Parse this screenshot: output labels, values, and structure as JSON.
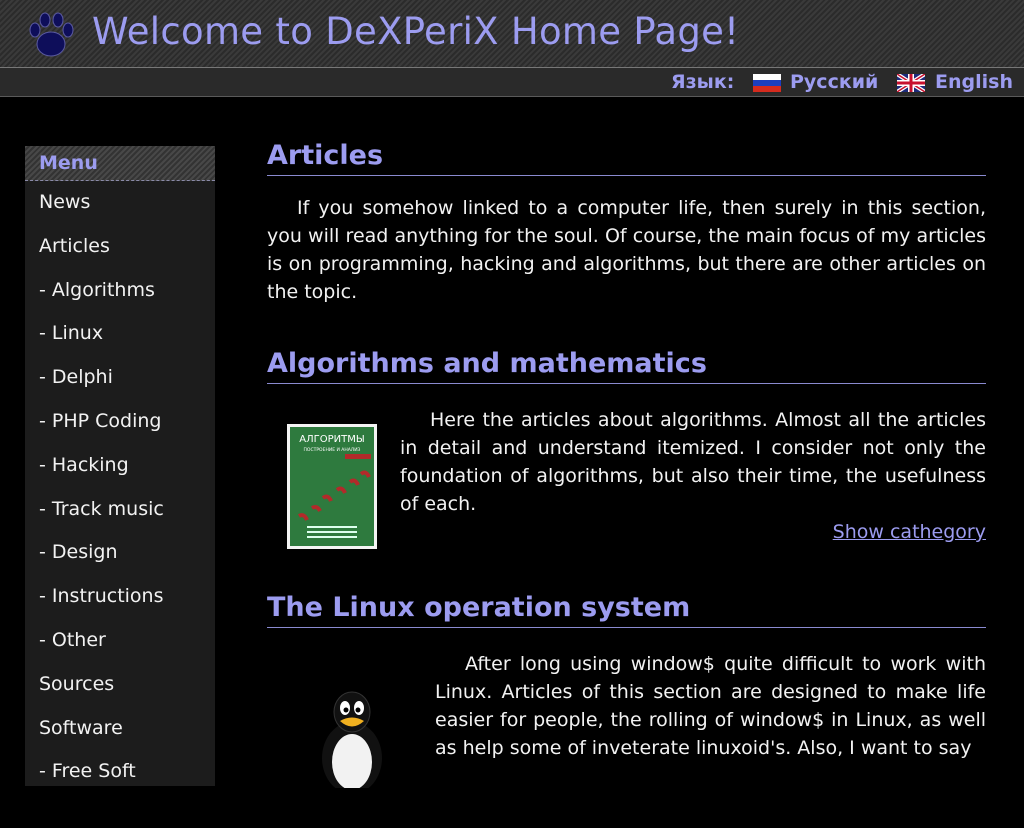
{
  "header": {
    "title": "Welcome to DeXPeriX Home Page!",
    "logo_icon": "paw-icon"
  },
  "lang": {
    "label": "Язык:",
    "russian": "Русский",
    "english": "English"
  },
  "menu": {
    "heading": "Menu",
    "items": [
      "News",
      "Articles",
      "- Algorithms",
      "- Linux",
      "- Delphi",
      "- PHP Coding",
      "- Hacking",
      "- Track music",
      "- Design",
      "- Instructions",
      "- Other",
      "Sources",
      "Software",
      "- Free Soft"
    ]
  },
  "main": {
    "articles_title": "Articles",
    "articles_intro": "If you somehow linked to a computer life, then surely in this section, you will read anything for the soul. Of course, the main focus of my articles is on programming, hacking and algorithms, but there are other articles on the topic.",
    "algorithms": {
      "title": "Algorithms and mathematics",
      "text": "Here the articles about algorithms. Almost all the articles in detail and understand itemized. I consider not only the foundation of algorithms, but also their time, the usefulness of each.",
      "link": "Show cathegory",
      "book_title": "АЛГОРИТМЫ",
      "book_subtitle": "ПОСТРОЕНИЕ И АНАЛИЗ"
    },
    "linux": {
      "title": "The Linux operation system",
      "text": "After long using window$ quite difficult to work with Linux. Articles of this section are designed to make life easier for people, the rolling of window$ in Linux, as well as help some of inveterate linuxoid's. Also, I want to say"
    }
  },
  "colors": {
    "accent": "#9c9cf0",
    "background": "#000000",
    "text": "#f2f2f2"
  }
}
